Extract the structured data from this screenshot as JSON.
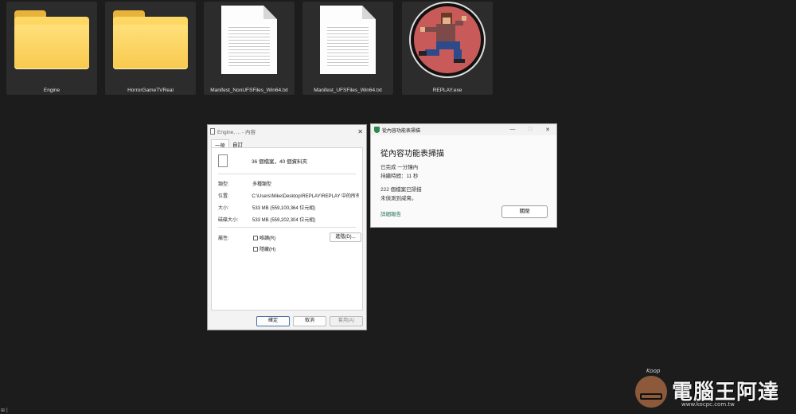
{
  "files": [
    {
      "name": "Engine",
      "icon": "folder-icon"
    },
    {
      "name": "HorrorGameTVReal",
      "icon": "folder-icon"
    },
    {
      "name": "Manifest_NonUFSFiles_Win64.txt",
      "icon": "text-file-icon"
    },
    {
      "name": "Manifest_UFSFiles_Win64.txt",
      "icon": "text-file-icon"
    },
    {
      "name": "REPLAY.exe",
      "icon": "app-icon"
    }
  ],
  "properties": {
    "title": "Engine, ... - 內容",
    "tabs": [
      "一般",
      "自訂"
    ],
    "summary": "36 個檔案，40 個資料夾",
    "type_label": "類型:",
    "type_value": "多種類型",
    "location_label": "位置:",
    "location_value": "C:\\Users\\Mike\\Desktop\\REPLAY\\REPLAY 中的所有",
    "size_label": "大小:",
    "size_value": "533 MB (559,100,364 位元組)",
    "disk_label": "磁碟大小:",
    "disk_value": "533 MB (559,202,304 位元組)",
    "attr_label": "屬性:",
    "readonly_label": "唯讀(R)",
    "hidden_label": "隱藏(H)",
    "advanced_label": "進階(D)...",
    "ok_label": "確定",
    "cancel_label": "取消",
    "apply_label": "套用(A)"
  },
  "scan": {
    "window_title": "從內容功能表掃描",
    "heading": "從內容功能表掃描",
    "status1": "已完成 一分鐘內",
    "status2": "持續時間：11 秒",
    "count": "222 個檔案已掃描",
    "result": "未偵測到威脅。",
    "report_link": "詳細報告",
    "close_label": "關閉",
    "minimize": "—",
    "maximize": "□",
    "close_x": "✕"
  },
  "watermark": {
    "text": "電腦王阿達",
    "url": "www.kocpc.com.tw",
    "signature": "Koop"
  },
  "taskbar_hint": "⊞ |"
}
